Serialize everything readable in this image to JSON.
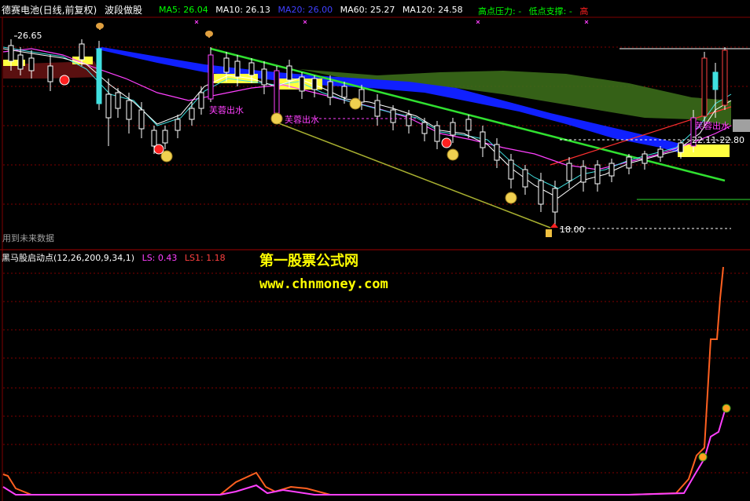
{
  "header": {
    "stock_name": "德赛电池(日线,前复权)",
    "formula_name": "波段做股",
    "ma5": "MA5: 26.04",
    "ma10": "MA10: 26.13",
    "ma20": "MA20: 26.00",
    "ma60": "MA60: 25.27",
    "ma120": "MA120: 24.58",
    "pressure": "高点压力: -",
    "support": "低点支撑: -",
    "high_cut": "高",
    "colors": {
      "ma5": "#00ff00",
      "ma10": "#ffffff",
      "ma20": "#4040ff",
      "ma60": "#ffffff",
      "ma120": "#ffffff",
      "pressure": "#00ff00",
      "support": "#00ff00",
      "high_cut": "#ff2020"
    }
  },
  "main_chart": {
    "price_top_label": "26.65",
    "price_bottom_label": "18.00",
    "price_right_label": "22.11-22.80",
    "signal_label_1": "芙蓉出水",
    "signal_label_2": "芙蓉出水",
    "signal_label_3": "芙蓉出水",
    "future_data_note": "用到未来数据"
  },
  "sub_chart": {
    "indicator_name": "黑马股启动点(12,26,200,9,34,1)",
    "ls": "LS: 0.43",
    "ls1": "LS1: 1.18",
    "ls_color": "#ff40ff",
    "ls1_color": "#ff4040"
  },
  "watermark": {
    "line1": "第一股票公式网",
    "line2": "www.chnmoney.com"
  },
  "icons": [
    "candlestick-chart",
    "smiley-icon",
    "red-cross-icon",
    "peach-icon",
    "mushroom-icon"
  ]
}
